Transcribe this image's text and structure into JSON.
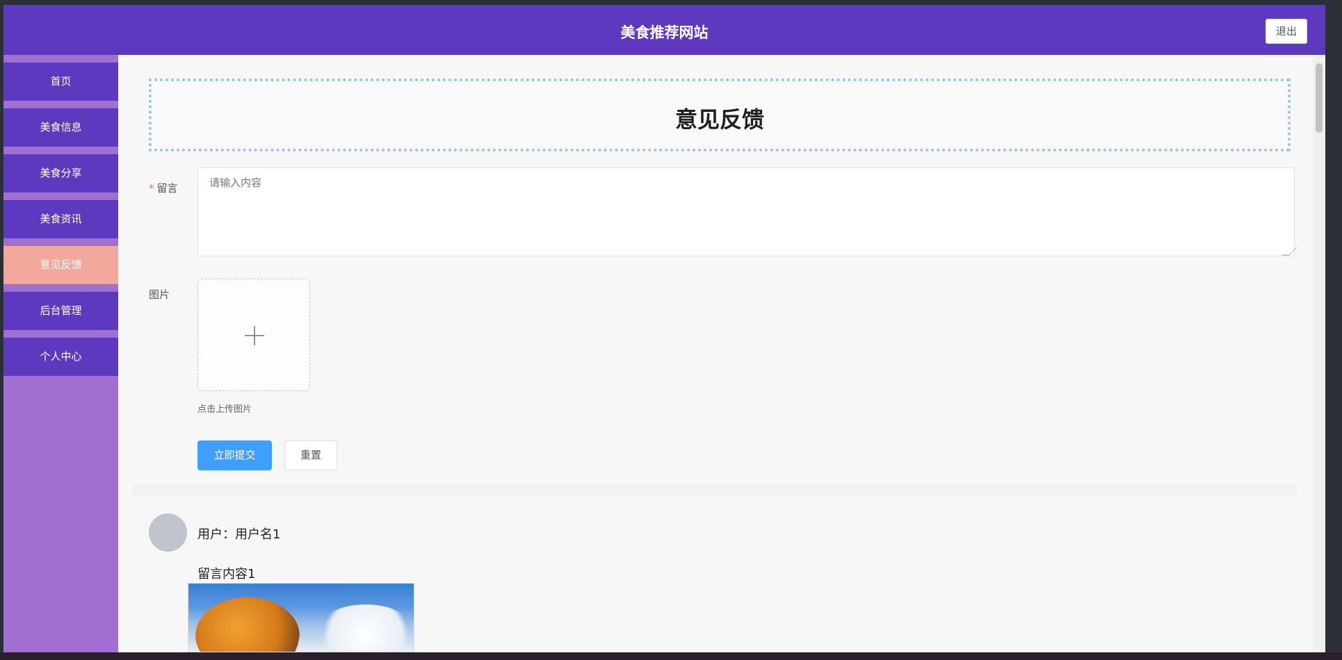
{
  "header": {
    "title": "美食推荐网站",
    "logout_label": "退出"
  },
  "sidebar": {
    "items": [
      {
        "label": "首页"
      },
      {
        "label": "美食信息"
      },
      {
        "label": "美食分享"
      },
      {
        "label": "美食资讯"
      },
      {
        "label": "意见反馈",
        "active": true
      },
      {
        "label": "后台管理"
      },
      {
        "label": "个人中心"
      }
    ]
  },
  "page": {
    "title": "意见反馈"
  },
  "form": {
    "message_label": "留言",
    "required_mark": "*",
    "message_placeholder": "请输入内容",
    "image_label": "图片",
    "upload_tip": "点击上传图片",
    "submit_label": "立即提交",
    "reset_label": "重置"
  },
  "comments": [
    {
      "user": "用户：用户名1",
      "content": "留言内容1"
    }
  ],
  "colors": {
    "header_bg": "#5d39bf",
    "sidebar_bg": "#a06fcf",
    "nav_item_bg": "#5d39bf",
    "nav_active_bg": "#f3a89c",
    "primary_button": "#409eff",
    "banner_border": "#8fc9e6"
  },
  "icons": {
    "upload": "plus-icon"
  }
}
